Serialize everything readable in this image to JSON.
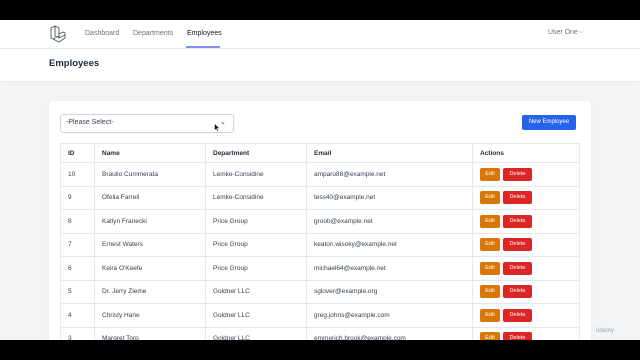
{
  "nav": {
    "links": [
      "Dashboard",
      "Departments",
      "Employees"
    ],
    "active": "Employees",
    "user": "User One"
  },
  "header": {
    "title": "Employees"
  },
  "filter": {
    "selected": "-Please Select-"
  },
  "toolbar": {
    "new_label": "New Employee"
  },
  "table": {
    "columns": [
      "ID",
      "Name",
      "Department",
      "Email",
      "Actions"
    ],
    "edit_label": "Edit",
    "delete_label": "Delete",
    "rows": [
      {
        "id": "10",
        "name": "Braulio Cummerata",
        "department": "Lemke-Considine",
        "email": "amparo88@example.net"
      },
      {
        "id": "9",
        "name": "Ofelia Farrell",
        "department": "Lemke-Considine",
        "email": "tess40@example.net"
      },
      {
        "id": "8",
        "name": "Katlyn Franecki",
        "department": "Price Group",
        "email": "groob@example.net"
      },
      {
        "id": "7",
        "name": "Ernest Waters",
        "department": "Price Group",
        "email": "keaton.wisoky@example.net"
      },
      {
        "id": "6",
        "name": "Keira O'Keefe",
        "department": "Price Group",
        "email": "michael64@example.net"
      },
      {
        "id": "5",
        "name": "Dr. Jerry Zieme",
        "department": "Goldner LLC",
        "email": "sglover@example.org"
      },
      {
        "id": "4",
        "name": "Christy Hane",
        "department": "Goldner LLC",
        "email": "greg.johns@example.com"
      },
      {
        "id": "3",
        "name": "Margret Torp",
        "department": "Goldner LLC",
        "email": "emmerich.brook@example.com"
      }
    ]
  },
  "watermark": "üdemy",
  "colors": {
    "primary": "#2563eb",
    "edit": "#d97706",
    "delete": "#dc2626",
    "nav_active": "#818cf8"
  }
}
